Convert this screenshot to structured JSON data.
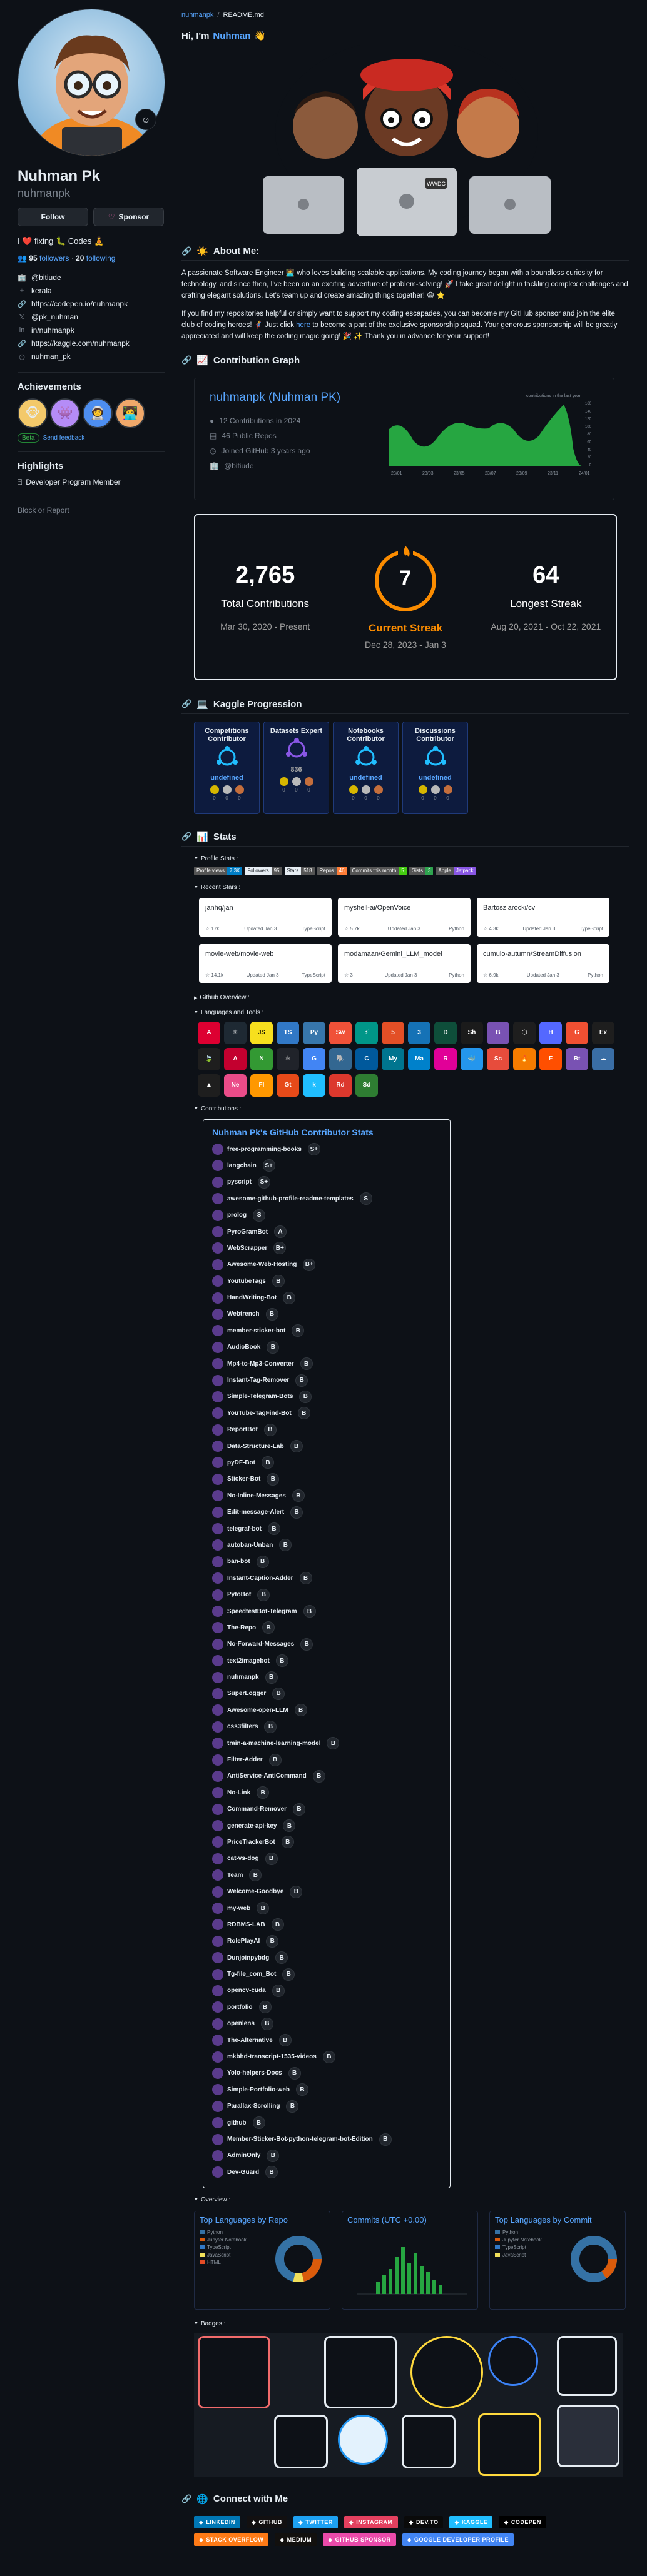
{
  "profile": {
    "name": "Nuhman Pk",
    "username": "nuhmanpk",
    "follow_label": "Follow",
    "sponsor_label": "Sponsor",
    "bio": "I ❤️ fixing 🐛 Codes 🧘",
    "followers_count": "95",
    "followers_label": "followers",
    "following_count": "20",
    "following_label": "following",
    "links": [
      {
        "icon": "building-icon",
        "text": "@bitiude"
      },
      {
        "icon": "location-icon",
        "text": "kerala"
      },
      {
        "icon": "link-icon",
        "text": "https://codepen.io/nuhmanpk"
      },
      {
        "icon": "x-icon",
        "text": "@pk_nuhman"
      },
      {
        "icon": "linkedin-icon",
        "text": "in/nuhmanpk"
      },
      {
        "icon": "link-icon",
        "text": "https://kaggle.com/nuhmanpk"
      },
      {
        "icon": "instagram-icon",
        "text": "nuhman_pk"
      }
    ],
    "achievements_title": "Achievements",
    "beta_label": "Beta",
    "feedback_label": "Send feedback",
    "highlights_title": "Highlights",
    "highlight_item": "Developer Program Member",
    "block_label": "Block or Report"
  },
  "readme": {
    "path_user": "nuhmanpk",
    "path_file": "README.md",
    "greeting_prefix": "Hi, I'm",
    "greeting_name": "Nuhman",
    "about_title": "About Me:",
    "about_p1": "A passionate Software Engineer 🧑‍💻 who loves building scalable applications. My coding journey began with a boundless curiosity for technology, and since then, I've been on an exciting adventure of problem-solving! 🚀 I take great delight in tackling complex challenges and crafting elegant solutions. Let's team up and create amazing things together! 😃 ⭐",
    "about_p2_a": "If you find my repositories helpful or simply want to support my coding escapades, you can become my GitHub sponsor and join the elite club of coding heroes! 🦸 Just click",
    "about_p2_link": "here",
    "about_p2_b": "to become a part of the exclusive sponsorship squad. Your generous sponsorship will be greatly appreciated and will keep the coding magic going! 🎉 ✨ Thank you in advance for your support!",
    "contrib_title": "Contribution Graph",
    "kaggle_title": "Kaggle Progression",
    "stats_title": "Stats",
    "connect_title": "Connect with Me"
  },
  "graph_card": {
    "title": "nuhmanpk (Nuhman PK)",
    "stats": [
      {
        "icon": "github-icon",
        "text": "12 Contributions in 2024"
      },
      {
        "icon": "repo-icon",
        "text": "46 Public Repos"
      },
      {
        "icon": "clock-icon",
        "text": "Joined GitHub 3 years ago"
      },
      {
        "icon": "building-icon",
        "text": "@bitiude"
      }
    ],
    "chart_label": "contributions in the last year",
    "x_ticks": [
      "23/01",
      "23/03",
      "23/05",
      "23/07",
      "23/09",
      "23/11",
      "24/01"
    ],
    "y_ticks": [
      "160",
      "140",
      "120",
      "100",
      "80",
      "60",
      "40",
      "20",
      "0"
    ]
  },
  "streak": {
    "total": "2,765",
    "total_label": "Total Contributions",
    "total_range": "Mar 30, 2020 - Present",
    "current": "7",
    "current_label": "Current Streak",
    "current_range": "Dec 28, 2023 - Jan 3",
    "longest": "64",
    "longest_label": "Longest Streak",
    "longest_range": "Aug 20, 2021 - Oct 22, 2021"
  },
  "kaggle": [
    {
      "title": "Competitions Contributor",
      "value": "undefined",
      "counts": [
        "0",
        "0",
        "0"
      ]
    },
    {
      "title": "Datasets Expert",
      "value": "836",
      "counts": [
        "0",
        "0",
        "0"
      ]
    },
    {
      "title": "Notebooks Contributor",
      "value": "undefined",
      "counts": [
        "0",
        "0",
        "0"
      ]
    },
    {
      "title": "Discussions Contributor",
      "value": "undefined",
      "counts": [
        "0",
        "0",
        "0"
      ]
    }
  ],
  "stats": {
    "profile_stats_label": "Profile Stats :",
    "shields": [
      {
        "k": "Profile views",
        "v": "7.3K",
        "kc": "#555555",
        "vc": "#007ec6"
      },
      {
        "k": "Followers",
        "v": "95",
        "kc": "#e6edf3",
        "vc": "#555555"
      },
      {
        "k": "Stars",
        "v": "518",
        "kc": "#e6edf3",
        "vc": "#555555"
      },
      {
        "k": "Repos",
        "v": "46",
        "kc": "#555555",
        "vc": "#fe7d37"
      },
      {
        "k": "Commits this month",
        "v": "5",
        "kc": "#555555",
        "vc": "#44cc11"
      },
      {
        "k": "Gists",
        "v": "3",
        "kc": "#555555",
        "vc": "#2ea44f"
      },
      {
        "k": "Apple",
        "v": "Jetpack",
        "kc": "#555555",
        "vc": "#8957e5"
      }
    ],
    "recent_stars_label": "Recent Stars :",
    "recent_stars": [
      {
        "name": "janhq/jan",
        "stars": "17k",
        "updated": "Updated Jan 3",
        "lang": "TypeScript"
      },
      {
        "name": "myshell-ai/OpenVoice",
        "stars": "5.7k",
        "updated": "Updated Jan 3",
        "lang": "Python"
      },
      {
        "name": "Bartoszlarocki/cv",
        "stars": "4.3k",
        "updated": "Updated Jan 3",
        "lang": "TypeScript"
      },
      {
        "name": "movie-web/movie-web",
        "stars": "14.1k",
        "updated": "Updated Jan 3",
        "lang": "TypeScript"
      },
      {
        "name": "modamaan/Gemini_LLM_model",
        "stars": "3",
        "updated": "Updated Jan 3",
        "lang": "Python"
      },
      {
        "name": "cumulo-autumn/StreamDiffusion",
        "stars": "6.9k",
        "updated": "Updated Jan 3",
        "lang": "Python"
      }
    ],
    "github_overview_label": "Github Overview :",
    "languages_label": "Languages and Tools :",
    "tools": [
      {
        "t": "A",
        "c": "#dd0031"
      },
      {
        "t": "⚛",
        "c": "#1e2933"
      },
      {
        "t": "JS",
        "c": "#f7df1e"
      },
      {
        "t": "TS",
        "c": "#3178c6"
      },
      {
        "t": "Py",
        "c": "#3776ab"
      },
      {
        "t": "Sw",
        "c": "#f05138"
      },
      {
        "t": "⚡",
        "c": "#009688"
      },
      {
        "t": "5",
        "c": "#e34f26"
      },
      {
        "t": "3",
        "c": "#1572b6"
      },
      {
        "t": "D",
        "c": "#0e4e3a"
      },
      {
        "t": "Sh",
        "c": "#1b1b1b"
      },
      {
        "t": "B",
        "c": "#7952b3"
      },
      {
        "t": "⬡",
        "c": "#1e1e1e"
      },
      {
        "t": "H",
        "c": "#5468ff"
      },
      {
        "t": "G",
        "c": "#f05032"
      },
      {
        "t": "Ex",
        "c": "#1e1e1e"
      },
      {
        "t": "🍃",
        "c": "#1e1e1e"
      },
      {
        "t": "A",
        "c": "#c3002f"
      },
      {
        "t": "N",
        "c": "#339933"
      },
      {
        "t": "⚛",
        "c": "#20232a"
      },
      {
        "t": "G",
        "c": "#4285f4"
      },
      {
        "t": "🐘",
        "c": "#336791"
      },
      {
        "t": "C",
        "c": "#00599c"
      },
      {
        "t": "My",
        "c": "#00758f"
      },
      {
        "t": "Ma",
        "c": "#0081cb"
      },
      {
        "t": "R",
        "c": "#e10098"
      },
      {
        "t": "🐳",
        "c": "#2496ed"
      },
      {
        "t": "Sc",
        "c": "#e74c3c"
      },
      {
        "t": "🔥",
        "c": "#f57c00"
      },
      {
        "t": "F",
        "c": "#ff4f00"
      },
      {
        "t": "Bt",
        "c": "#7952b3"
      },
      {
        "t": "☁",
        "c": "#3a6ea5"
      },
      {
        "t": "▲",
        "c": "#1e1e1e"
      },
      {
        "t": "Ne",
        "c": "#ea4c89"
      },
      {
        "t": "Fl",
        "c": "#ff9800"
      },
      {
        "t": "Gt",
        "c": "#e64a19"
      },
      {
        "t": "k",
        "c": "#20beff"
      },
      {
        "t": "Rd",
        "c": "#dc382d"
      },
      {
        "t": "Sd",
        "c": "#2e7d32"
      }
    ],
    "contributions_label": "Contributions :",
    "contrib_card_title": "Nuhman Pk's GitHub Contributor Stats",
    "contributions": [
      {
        "name": "free-programming-books",
        "g": "S+"
      },
      {
        "name": "langchain",
        "g": "S+"
      },
      {
        "name": "pyscript",
        "g": "S+"
      },
      {
        "name": "awesome-github-profile-readme-templates",
        "g": "S"
      },
      {
        "name": "prolog",
        "g": "S"
      },
      {
        "name": "PyroGramBot",
        "g": "A"
      },
      {
        "name": "WebScrapper",
        "g": "B+"
      },
      {
        "name": "Awesome-Web-Hosting",
        "g": "B+"
      },
      {
        "name": "YoutubeTags",
        "g": "B"
      },
      {
        "name": "HandWriting-Bot",
        "g": "B"
      },
      {
        "name": "Webtrench",
        "g": "B"
      },
      {
        "name": "member-sticker-bot",
        "g": "B"
      },
      {
        "name": "AudioBook",
        "g": "B"
      },
      {
        "name": "Mp4-to-Mp3-Converter",
        "g": "B"
      },
      {
        "name": "Instant-Tag-Remover",
        "g": "B"
      },
      {
        "name": "Simple-Telegram-Bots",
        "g": "B"
      },
      {
        "name": "YouTube-TagFind-Bot",
        "g": "B"
      },
      {
        "name": "ReportBot",
        "g": "B"
      },
      {
        "name": "Data-Structure-Lab",
        "g": "B"
      },
      {
        "name": "pyDF-Bot",
        "g": "B"
      },
      {
        "name": "Sticker-Bot",
        "g": "B"
      },
      {
        "name": "No-Inline-Messages",
        "g": "B"
      },
      {
        "name": "Edit-message-Alert",
        "g": "B"
      },
      {
        "name": "telegraf-bot",
        "g": "B"
      },
      {
        "name": "autoban-Unban",
        "g": "B"
      },
      {
        "name": "ban-bot",
        "g": "B"
      },
      {
        "name": "Instant-Caption-Adder",
        "g": "B"
      },
      {
        "name": "PytoBot",
        "g": "B"
      },
      {
        "name": "SpeedtestBot-Telegram",
        "g": "B"
      },
      {
        "name": "The-Repo",
        "g": "B"
      },
      {
        "name": "No-Forward-Messages",
        "g": "B"
      },
      {
        "name": "text2imagebot",
        "g": "B"
      },
      {
        "name": "nuhmanpk",
        "g": "B"
      },
      {
        "name": "SuperLogger",
        "g": "B"
      },
      {
        "name": "Awesome-open-LLM",
        "g": "B"
      },
      {
        "name": "css3filters",
        "g": "B"
      },
      {
        "name": "train-a-machine-learning-model",
        "g": "B"
      },
      {
        "name": "Filter-Adder",
        "g": "B"
      },
      {
        "name": "AntiService-AntiCommand",
        "g": "B"
      },
      {
        "name": "No-Link",
        "g": "B"
      },
      {
        "name": "Command-Remover",
        "g": "B"
      },
      {
        "name": "generate-api-key",
        "g": "B"
      },
      {
        "name": "PriceTrackerBot",
        "g": "B"
      },
      {
        "name": "cat-vs-dog",
        "g": "B"
      },
      {
        "name": "Team",
        "g": "B"
      },
      {
        "name": "Welcome-Goodbye",
        "g": "B"
      },
      {
        "name": "my-web",
        "g": "B"
      },
      {
        "name": "RDBMS-LAB",
        "g": "B"
      },
      {
        "name": "RolePlayAI",
        "g": "B"
      },
      {
        "name": "Dunjoinpybdg",
        "g": "B"
      },
      {
        "name": "Tg-file_com_Bot",
        "g": "B"
      },
      {
        "name": "opencv-cuda",
        "g": "B"
      },
      {
        "name": "portfolio",
        "g": "B"
      },
      {
        "name": "openlens",
        "g": "B"
      },
      {
        "name": "The-Alternative",
        "g": "B"
      },
      {
        "name": "mkbhd-transcript-1535-videos",
        "g": "B"
      },
      {
        "name": "Yolo-helpers-Docs",
        "g": "B"
      },
      {
        "name": "Simple-Portfolio-web",
        "g": "B"
      },
      {
        "name": "Parallax-Scrolling",
        "g": "B"
      },
      {
        "name": "github",
        "g": "B"
      },
      {
        "name": "Member-Sticker-Bot-python-telegram-bot-Edition",
        "g": "B"
      },
      {
        "name": "AdminOnly",
        "g": "B"
      },
      {
        "name": "Dev-Guard",
        "g": "B"
      }
    ],
    "overview_label": "Overview :",
    "overview_cards": [
      {
        "title": "Top Languages by Repo",
        "legend": [
          "Python",
          "Jupyter Notebook",
          "TypeScript",
          "JavaScript",
          "HTML"
        ]
      },
      {
        "title": "Commits (UTC +0.00)",
        "legend": []
      },
      {
        "title": "Top Languages by Commit",
        "legend": [
          "Python",
          "Jupyter Notebook",
          "TypeScript",
          "JavaScript"
        ]
      }
    ],
    "badges_label": "Badges :"
  },
  "connect": [
    {
      "label": "LINKEDIN",
      "color": "#0077b5",
      "icon": "linkedin-icon"
    },
    {
      "label": "GITHUB",
      "color": "#121011",
      "icon": "github-icon"
    },
    {
      "label": "TWITTER",
      "color": "#1da1f2",
      "icon": "twitter-icon"
    },
    {
      "label": "INSTAGRAM",
      "color": "#e4405f",
      "icon": "instagram-icon"
    },
    {
      "label": "DEV.TO",
      "color": "#0a0a0a",
      "icon": "devto-icon"
    },
    {
      "label": "KAGGLE",
      "color": "#20beff",
      "icon": "kaggle-icon"
    },
    {
      "label": "CODEPEN",
      "color": "#000000",
      "icon": "codepen-icon"
    },
    {
      "label": "STACK OVERFLOW",
      "color": "#fe7a16",
      "icon": "stackoverflow-icon"
    },
    {
      "label": "MEDIUM",
      "color": "#12100e",
      "icon": "medium-icon"
    },
    {
      "label": "GITHUB SPONSOR",
      "color": "#ea4aaa",
      "icon": "heart-icon"
    },
    {
      "label": "GOOGLE DEVELOPER PROFILE",
      "color": "#4285f4",
      "icon": "google-icon"
    }
  ],
  "colors": {
    "accent": "#58a6ff",
    "streak_orange": "#fb8c00",
    "graph_green": "#26a641",
    "background": "#0d1117"
  }
}
